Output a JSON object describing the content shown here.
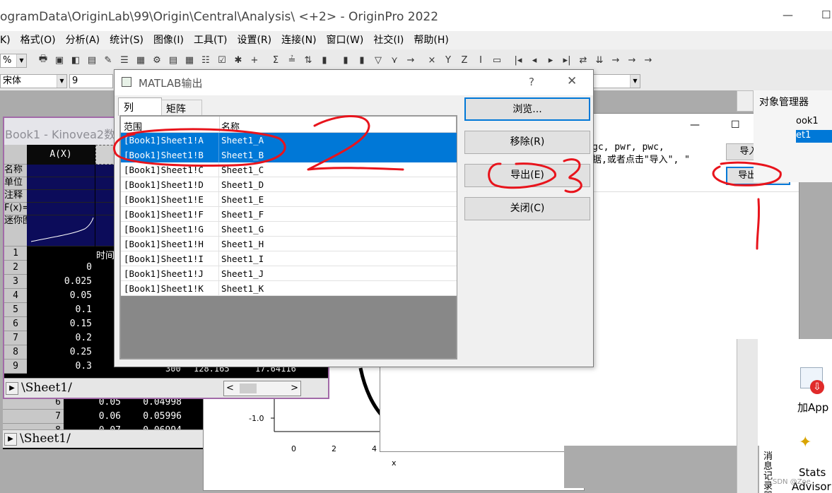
{
  "window": {
    "title": "ogramData\\OriginLab\\99\\Origin\\Central\\Analysis\\ <+2> - OriginPro 2022",
    "minimize_label": "—",
    "maximize_label": "☐"
  },
  "menu": [
    "K)",
    "格式(O)",
    "分析(A)",
    "统计(S)",
    "图像(I)",
    "工具(T)",
    "设置(R)",
    "连接(N)",
    "窗口(W)",
    "社交(I)",
    "帮助(H)"
  ],
  "toolbar": {
    "zoom_value": "%",
    "font_name": "宋体",
    "font_size": "9",
    "right_combo": "0",
    "toolbar_text_icons": [
      "Σ",
      "X",
      "Y",
      "Z",
      "I",
      "NONE",
      "I◂",
      "◂",
      "▸",
      "▸I"
    ]
  },
  "workbook": {
    "title": "Book1 - Kinovea2数据",
    "col_a_header": "A(X)",
    "row_labels": [
      "名称",
      "单位",
      "注释",
      "F(x)=",
      "迷你图"
    ],
    "second_col_partial": "时间",
    "rows": [
      {
        "n": "1",
        "a": ""
      },
      {
        "n": "2",
        "a": "0"
      },
      {
        "n": "3",
        "a": "0.025"
      },
      {
        "n": "4",
        "a": "0.05"
      },
      {
        "n": "5",
        "a": "0.1"
      },
      {
        "n": "6",
        "a": "0.15"
      },
      {
        "n": "7",
        "a": "0.2"
      },
      {
        "n": "8",
        "a": "0.25"
      },
      {
        "n": "9",
        "a": "0.3"
      }
    ],
    "partial_row9": [
      "300",
      "128.165",
      "17.64116"
    ],
    "sheet_tab": "Sheet1",
    "scroll_left": "<",
    "scroll_right": ">"
  },
  "background_sheet": {
    "rows": [
      {
        "n": "6",
        "a": "0.05",
        "b": "0.04998"
      },
      {
        "n": "7",
        "a": "0.06",
        "b": "0.05996"
      },
      {
        "n": "8",
        "a": "0.07",
        "b": "0.06994"
      }
    ],
    "sheet_tab": "Sheet1"
  },
  "plot": {
    "y_tick": "-1.0",
    "x_ticks": [
      "0",
      "2",
      "4"
    ],
    "x_label": "x"
  },
  "import_export_dialog": {
    "text_line1": "gc, pwr, pwc,",
    "text_line2": "据,或者点击\"导入\",  \"",
    "import_button": "导入(I)...",
    "export_button": "导出(E)...",
    "min": "—",
    "max": "☐",
    "close": "✕"
  },
  "matlab_dialog": {
    "title": "MATLAB输出",
    "help": "?",
    "close": "✕",
    "tabs": [
      "列",
      "矩阵"
    ],
    "col_headers": [
      "范围",
      "名称"
    ],
    "rows": [
      {
        "range": "[Book1]Sheet1!A",
        "name": "Sheet1_A",
        "selected": true
      },
      {
        "range": "[Book1]Sheet1!B",
        "name": "Sheet1_B",
        "selected": true
      },
      {
        "range": "[Book1]Sheet1!C",
        "name": "Sheet1_C",
        "selected": false
      },
      {
        "range": "[Book1]Sheet1!D",
        "name": "Sheet1_D",
        "selected": false
      },
      {
        "range": "[Book1]Sheet1!E",
        "name": "Sheet1_E",
        "selected": false
      },
      {
        "range": "[Book1]Sheet1!F",
        "name": "Sheet1_F",
        "selected": false
      },
      {
        "range": "[Book1]Sheet1!G",
        "name": "Sheet1_G",
        "selected": false
      },
      {
        "range": "[Book1]Sheet1!H",
        "name": "Sheet1_H",
        "selected": false
      },
      {
        "range": "[Book1]Sheet1!I",
        "name": "Sheet1_I",
        "selected": false
      },
      {
        "range": "[Book1]Sheet1!J",
        "name": "Sheet1_J",
        "selected": false
      },
      {
        "range": "[Book1]Sheet1!K",
        "name": "Sheet1_K",
        "selected": false
      }
    ],
    "buttons": {
      "browse": "浏览...",
      "remove": "移除(R)",
      "export": "导出(E)",
      "close": "关闭(C)"
    }
  },
  "object_manager": {
    "title": "对象管理器",
    "items": [
      "ook1",
      "et1"
    ]
  },
  "right_panel": {
    "app_label": "加App",
    "stats_label": "Stats",
    "advisor_label": "Advisor",
    "vertical_label": "消息记录器",
    "watermark": "CSDN @Zoe"
  },
  "annotations": {
    "numbers": [
      "1",
      "2",
      "3"
    ],
    "color": "#e8141c"
  },
  "colors": {
    "selection": "#0078d7",
    "sheet_bg": "#000000",
    "header_dark": "#0c0c5a"
  }
}
